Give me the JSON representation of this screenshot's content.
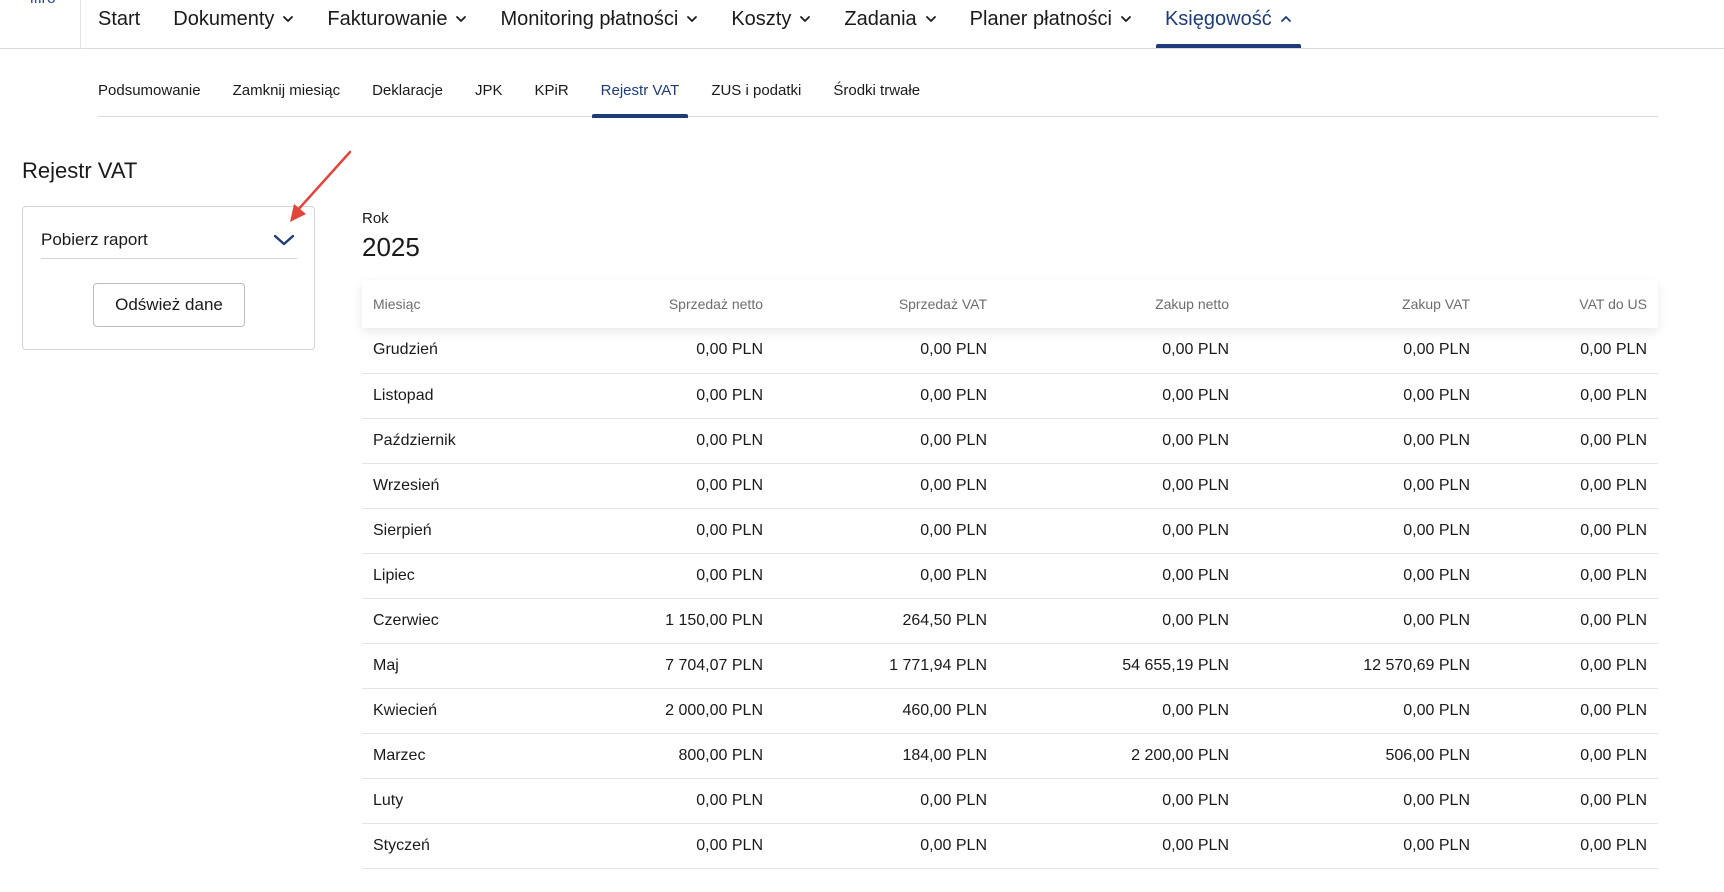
{
  "header": {
    "logo_fragment": "ifiro",
    "nav": [
      {
        "label": "Start",
        "has_dropdown": false,
        "active": false
      },
      {
        "label": "Dokumenty",
        "has_dropdown": true,
        "active": false
      },
      {
        "label": "Fakturowanie",
        "has_dropdown": true,
        "active": false
      },
      {
        "label": "Monitoring płatności",
        "has_dropdown": true,
        "active": false
      },
      {
        "label": "Koszty",
        "has_dropdown": true,
        "active": false
      },
      {
        "label": "Zadania",
        "has_dropdown": true,
        "active": false
      },
      {
        "label": "Planer płatności",
        "has_dropdown": true,
        "active": false
      },
      {
        "label": "Księgowość",
        "has_dropdown": true,
        "active": true
      }
    ]
  },
  "subnav": [
    {
      "label": "Podsumowanie",
      "active": false
    },
    {
      "label": "Zamknij miesiąc",
      "active": false
    },
    {
      "label": "Deklaracje",
      "active": false
    },
    {
      "label": "JPK",
      "active": false
    },
    {
      "label": "KPiR",
      "active": false
    },
    {
      "label": "Rejestr VAT",
      "active": true
    },
    {
      "label": "ZUS i podatki",
      "active": false
    },
    {
      "label": "Środki trwałe",
      "active": false
    }
  ],
  "page": {
    "title": "Rejestr VAT"
  },
  "panel": {
    "dropdown_label": "Pobierz raport",
    "refresh_label": "Odśwież dane"
  },
  "year": {
    "label": "Rok",
    "value": "2025"
  },
  "table": {
    "headers": [
      "Miesiąc",
      "Sprzedaż netto",
      "Sprzedaż VAT",
      "Zakup netto",
      "Zakup VAT",
      "VAT do US"
    ],
    "rows": [
      [
        "Grudzień",
        "0,00 PLN",
        "0,00 PLN",
        "0,00 PLN",
        "0,00 PLN",
        "0,00 PLN"
      ],
      [
        "Listopad",
        "0,00 PLN",
        "0,00 PLN",
        "0,00 PLN",
        "0,00 PLN",
        "0,00 PLN"
      ],
      [
        "Październik",
        "0,00 PLN",
        "0,00 PLN",
        "0,00 PLN",
        "0,00 PLN",
        "0,00 PLN"
      ],
      [
        "Wrzesień",
        "0,00 PLN",
        "0,00 PLN",
        "0,00 PLN",
        "0,00 PLN",
        "0,00 PLN"
      ],
      [
        "Sierpień",
        "0,00 PLN",
        "0,00 PLN",
        "0,00 PLN",
        "0,00 PLN",
        "0,00 PLN"
      ],
      [
        "Lipiec",
        "0,00 PLN",
        "0,00 PLN",
        "0,00 PLN",
        "0,00 PLN",
        "0,00 PLN"
      ],
      [
        "Czerwiec",
        "1 150,00 PLN",
        "264,50 PLN",
        "0,00 PLN",
        "0,00 PLN",
        "0,00 PLN"
      ],
      [
        "Maj",
        "7 704,07 PLN",
        "1 771,94 PLN",
        "54 655,19 PLN",
        "12 570,69 PLN",
        "0,00 PLN"
      ],
      [
        "Kwiecień",
        "2 000,00 PLN",
        "460,00 PLN",
        "0,00 PLN",
        "0,00 PLN",
        "0,00 PLN"
      ],
      [
        "Marzec",
        "800,00 PLN",
        "184,00 PLN",
        "2 200,00 PLN",
        "506,00 PLN",
        "0,00 PLN"
      ],
      [
        "Luty",
        "0,00 PLN",
        "0,00 PLN",
        "0,00 PLN",
        "0,00 PLN",
        "0,00 PLN"
      ],
      [
        "Styczeń",
        "0,00 PLN",
        "0,00 PLN",
        "0,00 PLN",
        "0,00 PLN",
        "0,00 PLN"
      ]
    ]
  },
  "colors": {
    "accent": "#1f3c78",
    "annotation_arrow": "#e0463c",
    "border": "#d9d9d9"
  },
  "icons": {
    "nav_dropdown": "chevron-down-icon",
    "nav_active": "chevron-up-icon",
    "report_dropdown": "chevron-down-icon",
    "annotation": "red-arrow-annotation"
  }
}
